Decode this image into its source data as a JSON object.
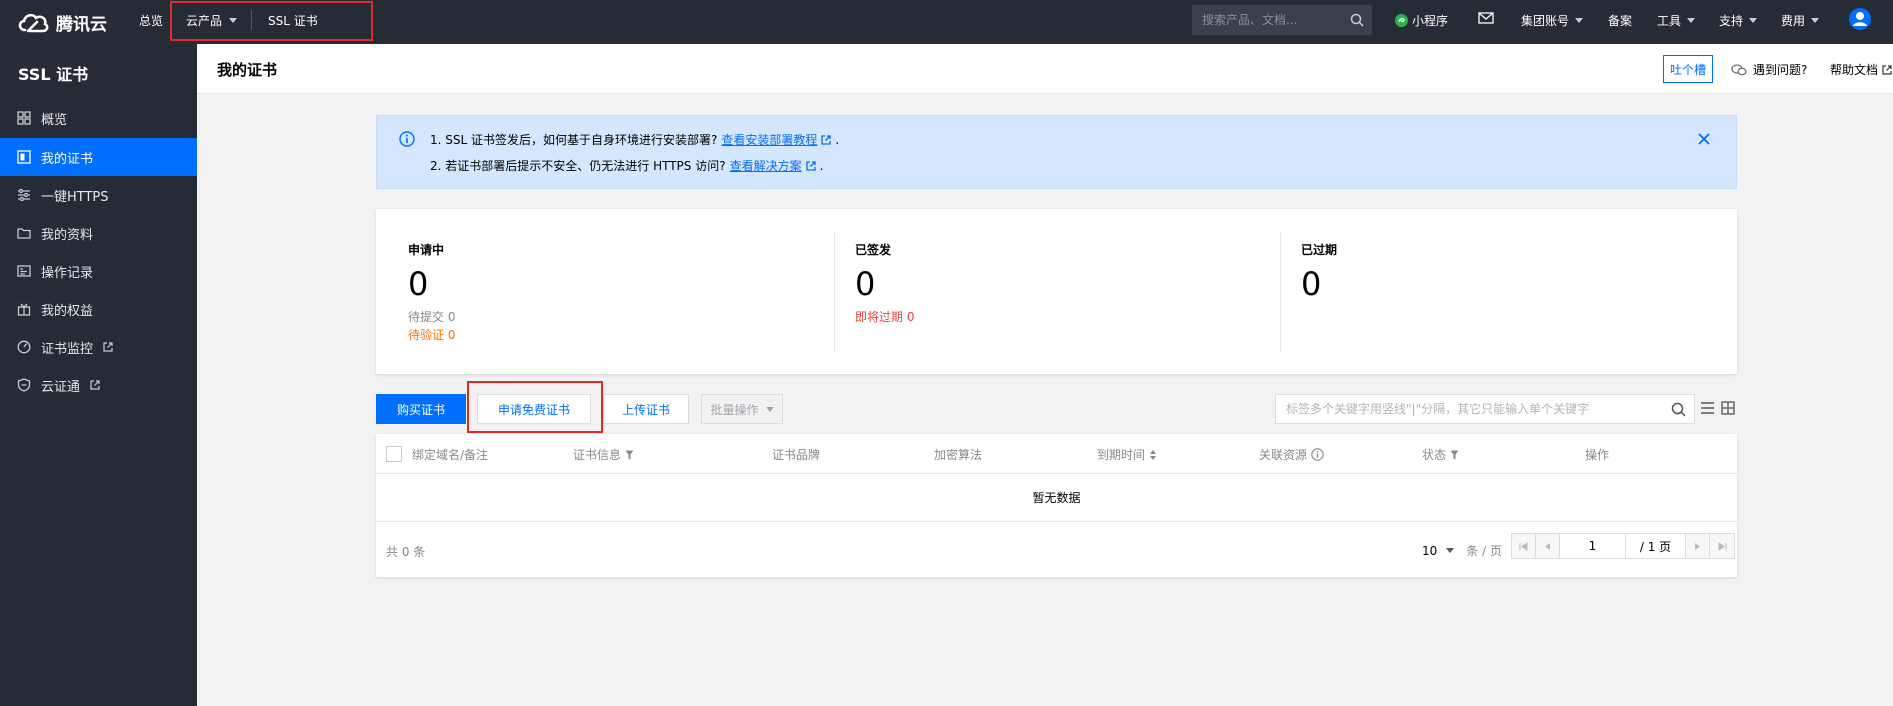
{
  "topbar": {
    "brand": "腾讯云",
    "overview": "总览",
    "products": "云产品",
    "ssl": "SSL 证书",
    "search_placeholder": "搜索产品、文档...",
    "miniprogram": "小程序",
    "group_account": "集团账号",
    "filing": "备案",
    "tools": "工具",
    "support": "支持",
    "billing": "费用"
  },
  "sidebar": {
    "title": "SSL 证书",
    "items": [
      {
        "label": "概览",
        "icon": "grid-icon"
      },
      {
        "label": "我的证书",
        "icon": "certificate-icon",
        "active": true
      },
      {
        "label": "一键HTTPS",
        "icon": "sliders-icon"
      },
      {
        "label": "我的资料",
        "icon": "folder-icon"
      },
      {
        "label": "操作记录",
        "icon": "log-icon"
      },
      {
        "label": "我的权益",
        "icon": "gift-icon"
      },
      {
        "label": "证书监控",
        "icon": "monitor-icon",
        "external": true
      },
      {
        "label": "云证通",
        "icon": "shield-icon",
        "external": true
      }
    ]
  },
  "header": {
    "title": "我的证书",
    "feedback": "吐个槽",
    "help_question": "遇到问题?",
    "help_doc": "帮助文档"
  },
  "notice": {
    "line1_text": "1. SSL 证书签发后，如何基于自身环境进行安装部署?",
    "line1_link": "查看安装部署教程",
    "line2_text": "2. 若证书部署后提示不安全、仍无法进行 HTTPS 访问?",
    "line2_link": "查看解决方案"
  },
  "stats": {
    "applying": {
      "label": "申请中",
      "value": "0",
      "sub1": "待提交 0",
      "sub2": "待验证 0"
    },
    "issued": {
      "label": "已签发",
      "value": "0",
      "sub1": "即将过期 0"
    },
    "expired": {
      "label": "已过期",
      "value": "0"
    }
  },
  "toolbar": {
    "buy": "购买证书",
    "apply_free": "申请免费证书",
    "upload": "上传证书",
    "batch": "批量操作",
    "search_placeholder": "标签多个关键字用竖线\"|\"分隔，其它只能输入单个关键字"
  },
  "table": {
    "columns": [
      "绑定域名/备注",
      "证书信息",
      "证书品牌",
      "加密算法",
      "到期时间",
      "关联资源",
      "状态",
      "操作"
    ],
    "empty": "暂无数据",
    "total": "共 0 条",
    "page_size": "10",
    "page_size_unit": "条 / 页",
    "current_page": "1",
    "total_pages": "/ 1 页"
  },
  "colors": {
    "topbar_bg": "#262c36",
    "accent": "#006eff",
    "warning": "#ff7200",
    "danger": "#e54545",
    "highlight_box": "#e5262c"
  }
}
